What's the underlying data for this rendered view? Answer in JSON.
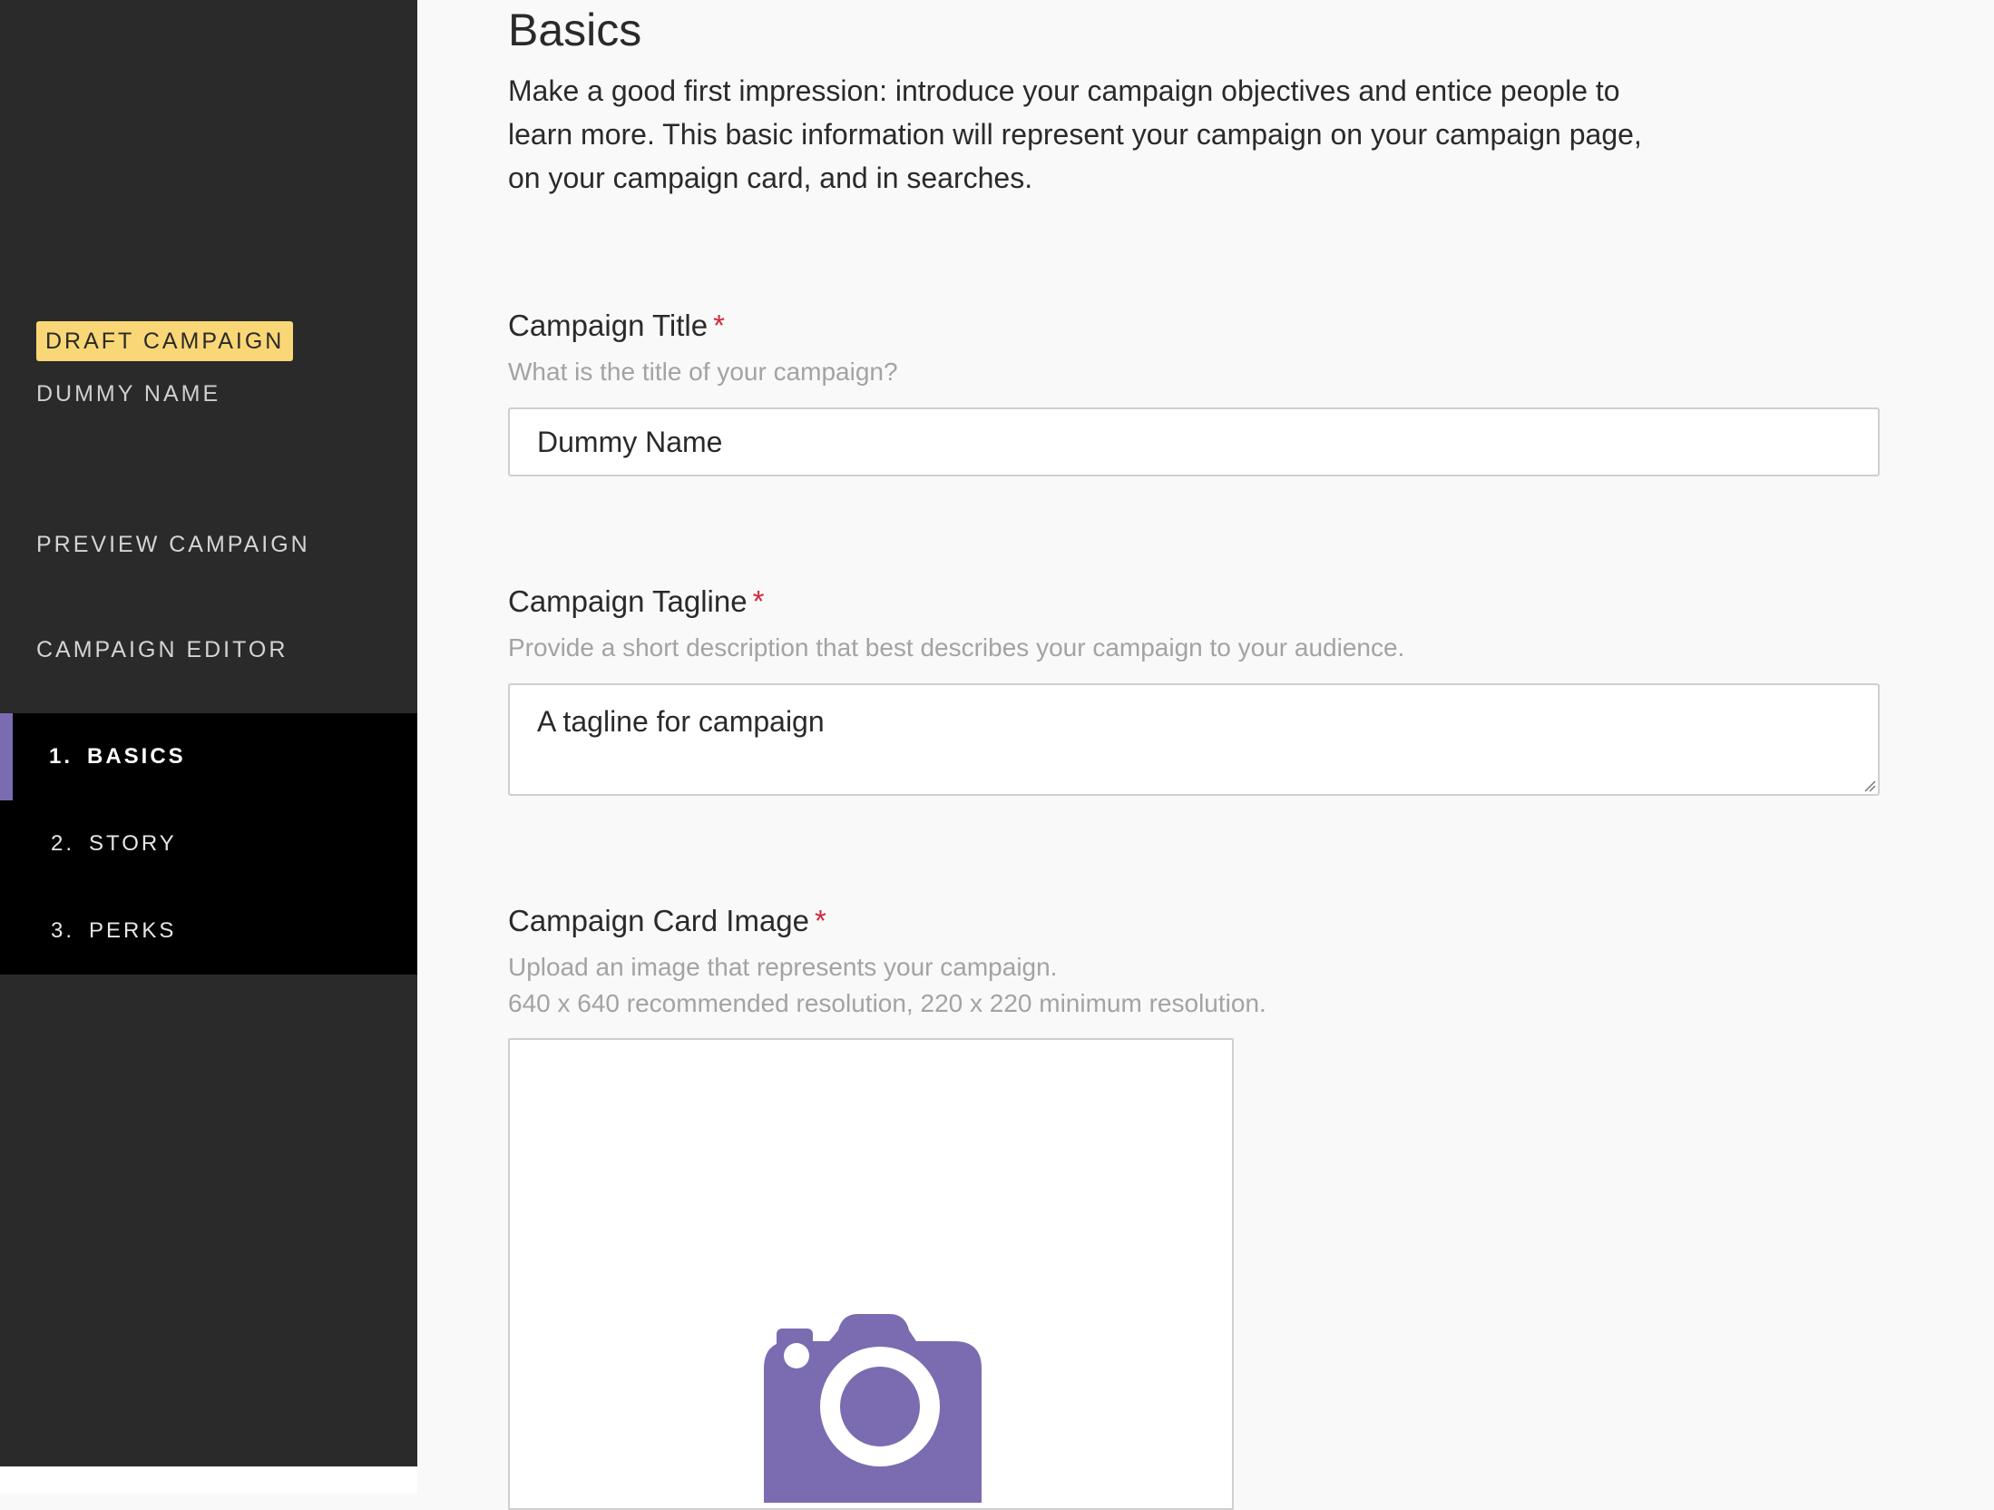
{
  "sidebar": {
    "badge": "DRAFT CAMPAIGN",
    "campaign_name": "DUMMY NAME",
    "links": {
      "preview": "PREVIEW CAMPAIGN",
      "editor": "CAMPAIGN EDITOR"
    },
    "steps": [
      {
        "num": "1.",
        "label": "BASICS",
        "active": true
      },
      {
        "num": "2.",
        "label": "STORY",
        "active": false
      },
      {
        "num": "3.",
        "label": "PERKS",
        "active": false
      }
    ]
  },
  "main": {
    "title": "Basics",
    "intro": "Make a good first impression: introduce your campaign objectives and entice people to learn more. This basic information will represent your campaign on your campaign page, on your campaign card, and in searches.",
    "fields": {
      "title": {
        "label": "Campaign Title",
        "required_mark": "*",
        "help": "What is the title of your campaign?",
        "value": "Dummy Name"
      },
      "tagline": {
        "label": "Campaign Tagline",
        "required_mark": "*",
        "help": "Provide a short description that best describes your campaign to your audience.",
        "value": "A tagline for campaign"
      },
      "card_image": {
        "label": "Campaign Card Image",
        "required_mark": "*",
        "help_line1": "Upload an image that represents your campaign.",
        "help_line2": "640 x 640 recommended resolution, 220 x 220 minimum resolution.",
        "icon": "camera-icon"
      }
    }
  },
  "colors": {
    "sidebar_bg": "#2a2a2a",
    "steps_bg": "#000000",
    "accent": "#7b6cb1",
    "badge_bg": "#fad776",
    "required": "#d0283a"
  }
}
